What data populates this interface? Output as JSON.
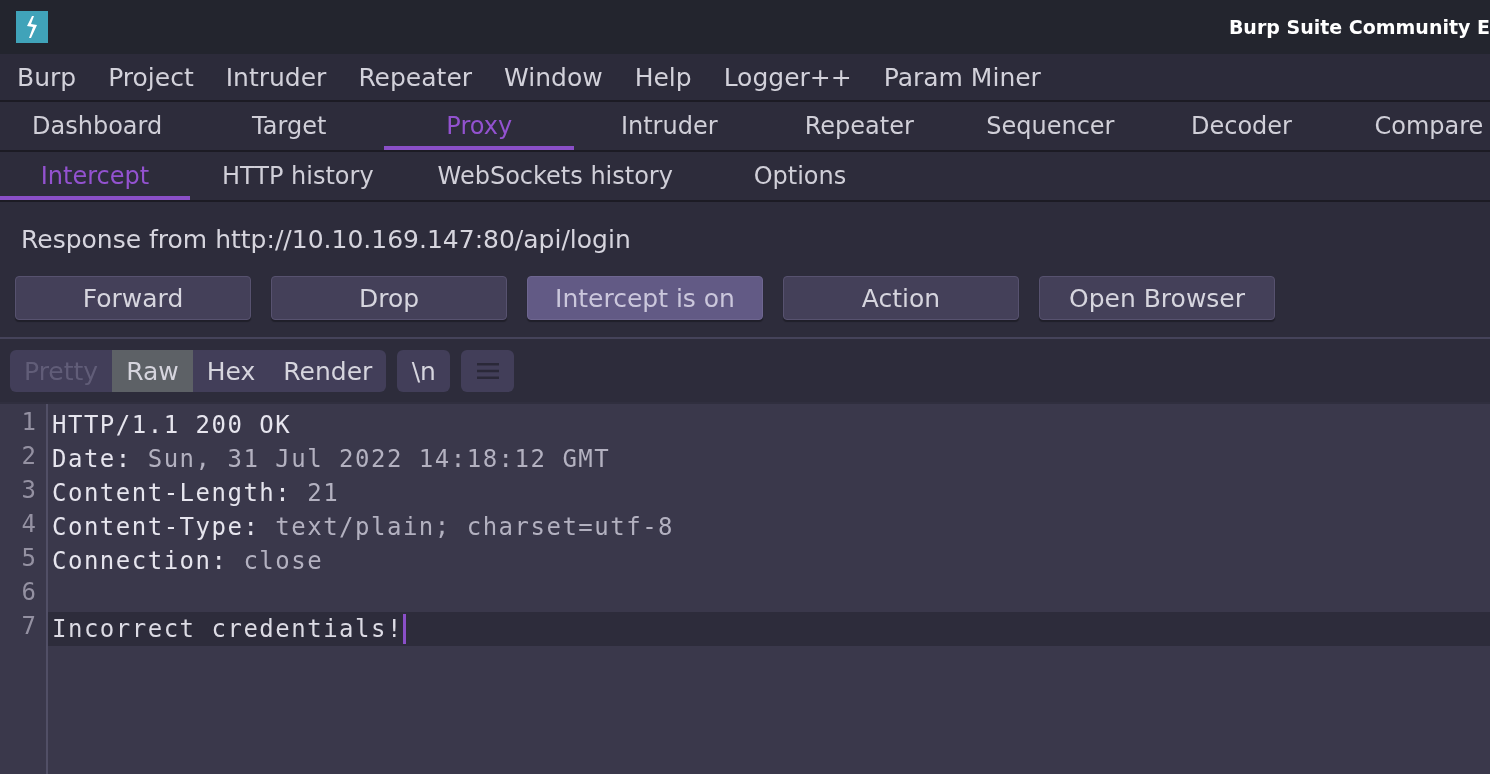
{
  "window": {
    "title": "Burp Suite Community E"
  },
  "menu_bar": [
    "Burp",
    "Project",
    "Intruder",
    "Repeater",
    "Window",
    "Help",
    "Logger++",
    "Param Miner"
  ],
  "tabs": [
    {
      "label": "Dashboard",
      "selected": false
    },
    {
      "label": "Target",
      "selected": false
    },
    {
      "label": "Proxy",
      "selected": true
    },
    {
      "label": "Intruder",
      "selected": false
    },
    {
      "label": "Repeater",
      "selected": false
    },
    {
      "label": "Sequencer",
      "selected": false
    },
    {
      "label": "Decoder",
      "selected": false
    },
    {
      "label": "Compare",
      "selected": false
    }
  ],
  "proxy_tabs": [
    {
      "label": "Intercept",
      "selected": true
    },
    {
      "label": "HTTP history",
      "selected": false
    },
    {
      "label": "WebSockets history",
      "selected": false
    },
    {
      "label": "Options",
      "selected": false
    }
  ],
  "intercept": {
    "status": "Response from http://10.10.169.147:80/api/login",
    "buttons": [
      {
        "label": "Forward",
        "pressed": false
      },
      {
        "label": "Drop",
        "pressed": false
      },
      {
        "label": "Intercept is on",
        "pressed": true
      },
      {
        "label": "Action",
        "pressed": false
      },
      {
        "label": "Open Browser",
        "pressed": false
      }
    ]
  },
  "editor": {
    "view_modes": [
      {
        "label": "Pretty",
        "selected": false,
        "disabled": true
      },
      {
        "label": "Raw",
        "selected": true,
        "disabled": false
      },
      {
        "label": "Hex",
        "selected": false,
        "disabled": false
      },
      {
        "label": "Render",
        "selected": false,
        "disabled": false
      }
    ],
    "newline_button": "\\n",
    "lines": [
      {
        "number": "1",
        "kind": "status",
        "text": "HTTP/1.1 200 OK",
        "current": false
      },
      {
        "number": "2",
        "kind": "header",
        "name": "Date:",
        "value": "Sun, 31 Jul 2022 14:18:12 GMT",
        "current": false
      },
      {
        "number": "3",
        "kind": "header",
        "name": "Content-Length:",
        "value": "21",
        "current": false
      },
      {
        "number": "4",
        "kind": "header",
        "name": "Content-Type:",
        "value": "text/plain; charset=utf-8",
        "current": false
      },
      {
        "number": "5",
        "kind": "header",
        "name": "Connection:",
        "value": "close",
        "current": false
      },
      {
        "number": "6",
        "kind": "blank",
        "current": false
      },
      {
        "number": "7",
        "kind": "body",
        "text": "Incorrect credentials!",
        "current": true
      }
    ]
  }
}
